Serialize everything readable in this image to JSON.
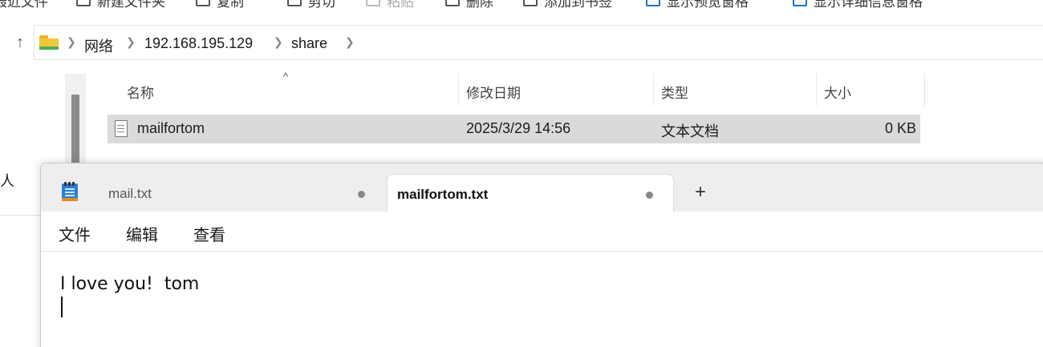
{
  "toolbar": {
    "items": [
      {
        "label": "最近文件",
        "icon": "recent-icon"
      },
      {
        "label": "新建文件夹",
        "icon": "new-folder-icon"
      },
      {
        "label": "复制",
        "icon": "copy-icon"
      },
      {
        "label": "剪切",
        "icon": "cut-icon"
      },
      {
        "label": "粘贴",
        "icon": "paste-icon"
      },
      {
        "label": "删除",
        "icon": "delete-icon"
      },
      {
        "label": "添加到书签",
        "icon": "bookmark-icon"
      },
      {
        "label": "显示预览窗格",
        "icon": "preview-pane-icon"
      },
      {
        "label": "显示详细信息窗格",
        "icon": "details-pane-icon"
      }
    ]
  },
  "address": {
    "crumbs": [
      "网络",
      "192.168.195.129",
      "share"
    ]
  },
  "left_pane": {
    "fragment": "人"
  },
  "file_list": {
    "columns": [
      "名称",
      "修改日期",
      "类型",
      "大小"
    ],
    "rows": [
      {
        "name": "mailfortom",
        "modified": "2025/3/29 14:56",
        "type": "文本文档",
        "size": "0 KB"
      }
    ]
  },
  "notepad": {
    "tabs": [
      {
        "title": "mail.txt",
        "active": false
      },
      {
        "title": "mailfortom.txt",
        "active": true
      }
    ],
    "new_tab_label": "+",
    "menu": [
      "文件",
      "编辑",
      "查看"
    ],
    "content": "I love you!  tom"
  },
  "colors": {
    "selection": "#dadada",
    "folder": "#f5c63b",
    "notepad_icon": "#2a7fd4"
  }
}
